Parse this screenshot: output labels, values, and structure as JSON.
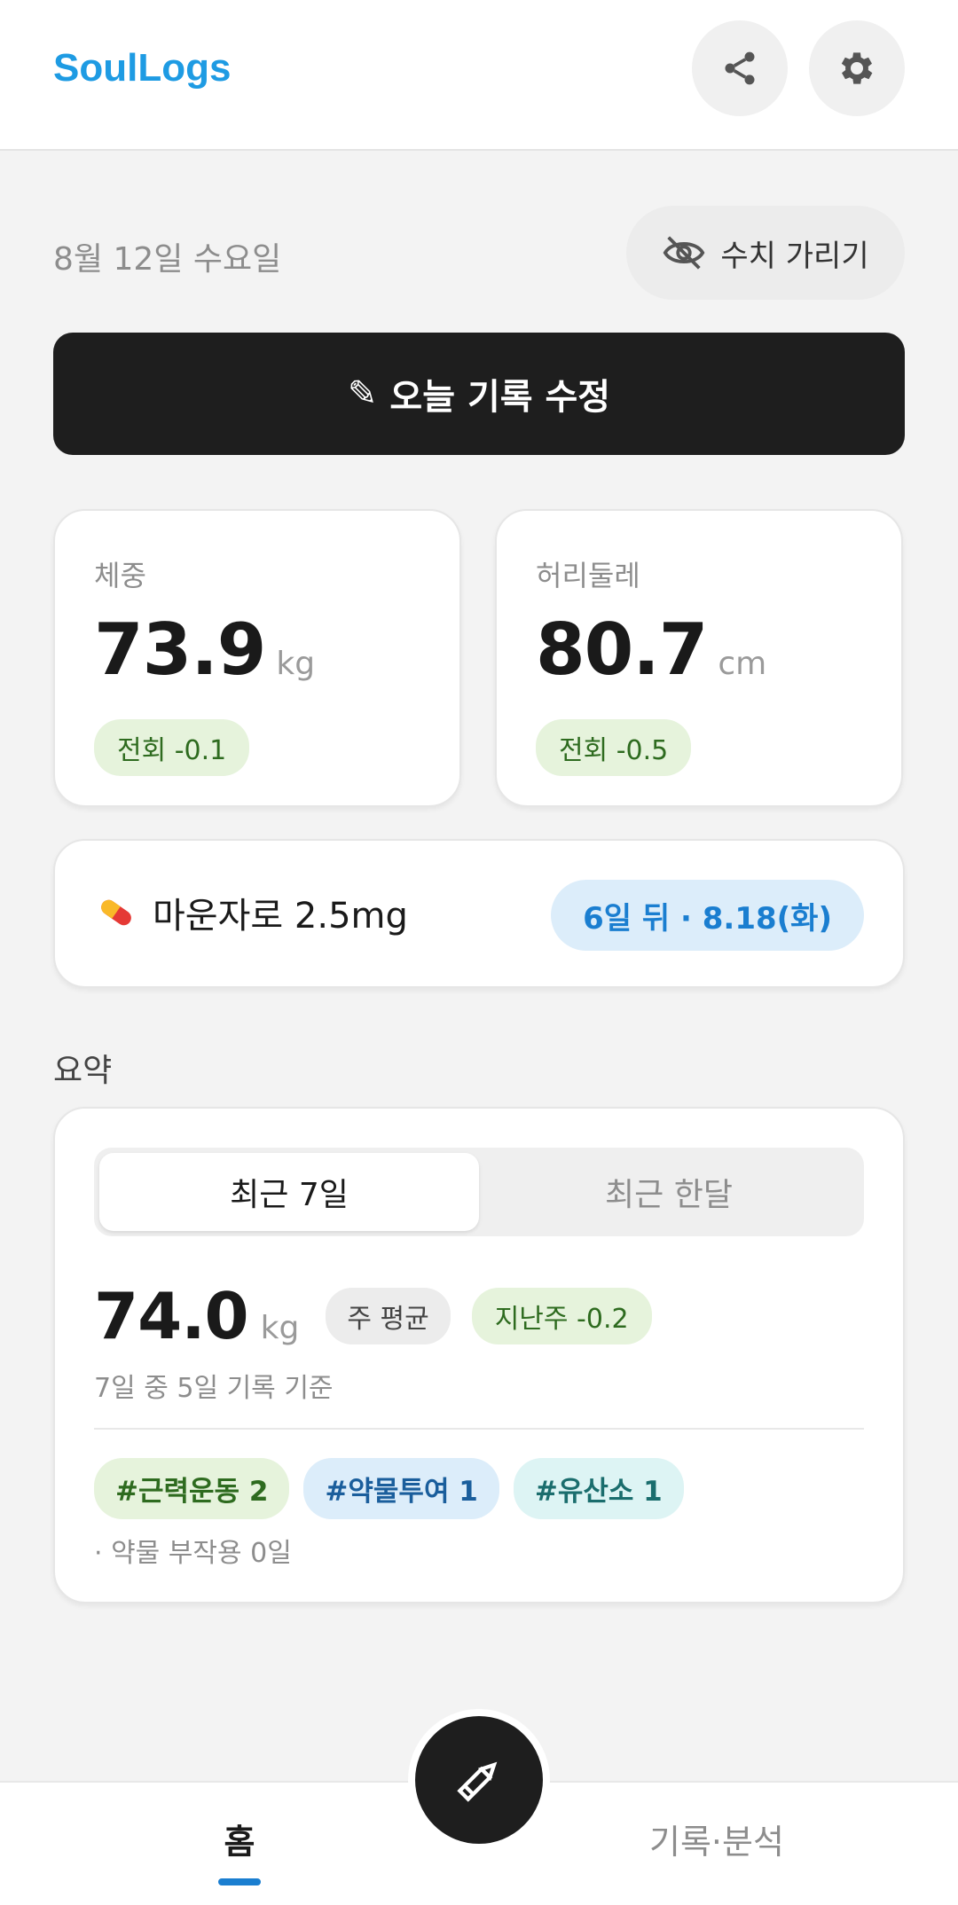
{
  "header": {
    "brand": "SoulLogs",
    "icons": {
      "share": "share-icon",
      "settings": "gear-icon"
    }
  },
  "date_row": {
    "date": "8월 12일 수요일",
    "hide_values_label": "수치 가리기",
    "hide_icon": "eye-off-icon"
  },
  "edit_button": {
    "icon": "✎",
    "label": "오늘 기록 수정"
  },
  "stats": {
    "weight": {
      "label": "체중",
      "value": "73.9",
      "unit": "kg",
      "delta": "전회 -0.1"
    },
    "waist": {
      "label": "허리둘레",
      "value": "80.7",
      "unit": "cm",
      "delta": "전회 -0.5"
    }
  },
  "medication": {
    "icon": "💊",
    "name": "마운자로 2.5mg",
    "next_dose": "6일 뒤 · 8.18(화)"
  },
  "summary": {
    "section_title": "요약",
    "tabs": [
      {
        "label": "최근 7일",
        "active": true
      },
      {
        "label": "최근 한달",
        "active": false
      }
    ],
    "avg_value": "74.0",
    "avg_unit": "kg",
    "avg_badge": "주 평균",
    "change_badge": "지난주 -0.2",
    "basis": "7일 중 5일 기록 기준",
    "tags": [
      "#근력운동 2",
      "#약물투여 1",
      "#유산소 1"
    ],
    "side_effect_note": "· 약물 부작용 0일"
  },
  "bottom_nav": {
    "home": "홈",
    "records": "기록·분석",
    "fab_icon": "✎"
  },
  "colors": {
    "brand": "#1e9be3",
    "accent_blue": "#1a7ed0",
    "dark_button": "#1e1e1e",
    "green_badge_bg": "#e6f3dc",
    "blue_badge_bg": "#dcedfa"
  }
}
